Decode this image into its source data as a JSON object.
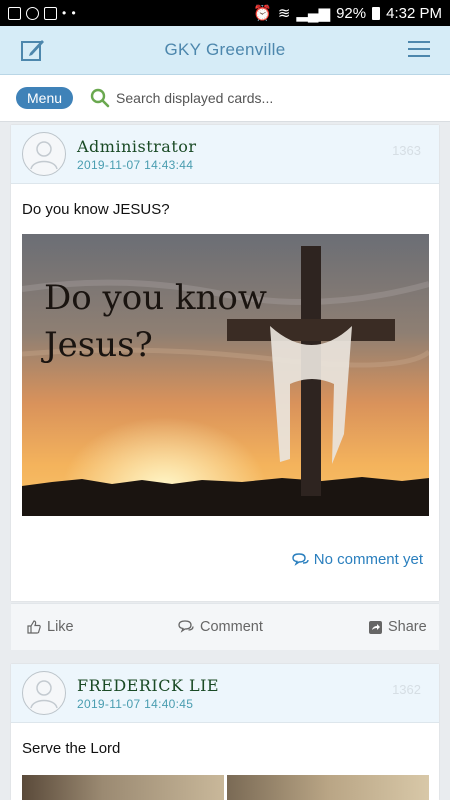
{
  "status_bar": {
    "battery": "92%",
    "time": "4:32 PM"
  },
  "app": {
    "title": "GKY Greenville"
  },
  "toolbar": {
    "menu_label": "Menu",
    "search_placeholder": "Search displayed cards..."
  },
  "posts": [
    {
      "author": "Administrator",
      "timestamp": "2019-11-07 14:43:44",
      "id": "1363",
      "text": "Do you know JESUS?",
      "image_caption": [
        "Do you know",
        "Jesus?"
      ],
      "comment_label": "No comment yet",
      "actions": {
        "like": "Like",
        "comment": "Comment",
        "share": "Share"
      }
    },
    {
      "author": "FREDERICK LIE",
      "timestamp": "2019-11-07 14:40:45",
      "id": "1362",
      "text": "Serve the Lord"
    }
  ],
  "colors": {
    "header_bg": "#d6ecf7",
    "accent": "#3f82b8",
    "link": "#2a7fbe"
  }
}
